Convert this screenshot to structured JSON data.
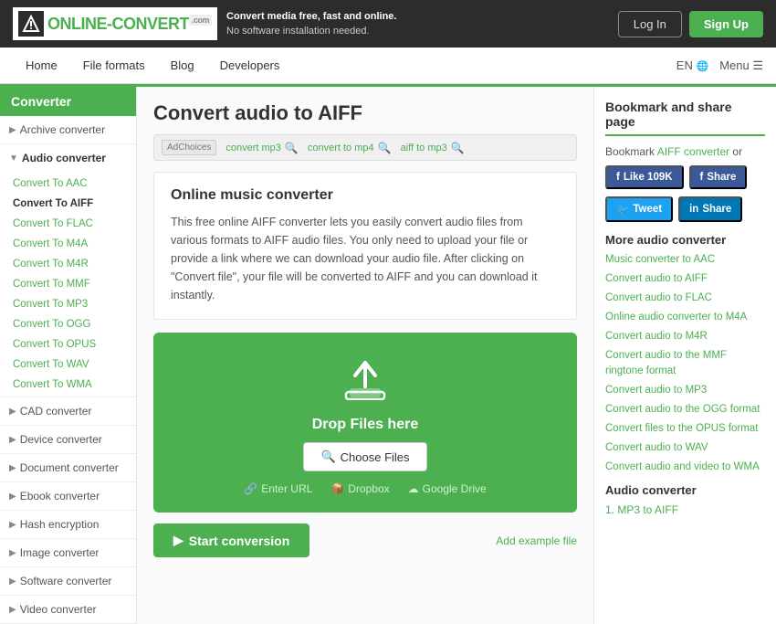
{
  "header": {
    "logo_text": "ONLINE",
    "logo_dash": "-",
    "logo_convert": "CONVERT",
    "logo_com": ".com",
    "tagline_main": "Convert media free, fast and online.",
    "tagline_sub": "No software installation needed.",
    "login_label": "Log In",
    "signup_label": "Sign Up"
  },
  "nav": {
    "items": [
      {
        "label": "Home"
      },
      {
        "label": "File formats"
      },
      {
        "label": "Blog"
      },
      {
        "label": "Developers"
      }
    ],
    "lang": "EN",
    "menu": "Menu"
  },
  "sidebar": {
    "title": "Converter",
    "sections": [
      {
        "label": "Archive converter",
        "open": false
      },
      {
        "label": "Audio converter",
        "open": true,
        "items": [
          "Convert To AAC",
          "Convert To AIFF",
          "Convert To FLAC",
          "Convert To M4A",
          "Convert To M4R",
          "Convert To MMF",
          "Convert To MP3",
          "Convert To OGG",
          "Convert To OPUS",
          "Convert To WAV",
          "Convert To WMA"
        ]
      },
      {
        "label": "CAD converter",
        "open": false
      },
      {
        "label": "Device converter",
        "open": false
      },
      {
        "label": "Document converter",
        "open": false
      },
      {
        "label": "Ebook converter",
        "open": false
      },
      {
        "label": "Hash encryption",
        "open": false
      },
      {
        "label": "Image converter",
        "open": false
      },
      {
        "label": "Software converter",
        "open": false
      },
      {
        "label": "Video converter",
        "open": false
      }
    ]
  },
  "main": {
    "page_title": "Convert audio to AIFF",
    "ad_label": "AdChoices",
    "ad_items": [
      {
        "text": "convert mp3"
      },
      {
        "text": "convert to mp4"
      },
      {
        "text": "aiff to mp3"
      }
    ],
    "converter_subtitle": "Online music converter",
    "converter_desc": "This free online AIFF converter lets you easily convert audio files from various formats to AIFF audio files. You only need to upload your file or provide a link where we can download your audio file. After clicking on \"Convert file\", your file will be converted to AIFF and you can download it instantly.",
    "drop_zone": {
      "drop_text": "Drop Files here",
      "choose_label": "Choose Files",
      "url_label": "Enter URL",
      "dropbox_label": "Dropbox",
      "gdrive_label": "Google Drive"
    },
    "start_label": "Start conversion",
    "add_example": "Add example file"
  },
  "right_sidebar": {
    "title": "Bookmark and share page",
    "bookmark_text": "Bookmark AIFF converter or",
    "bookmark_link": "AIFF converter",
    "social": {
      "like_label": "Like 109K",
      "share_fb_label": "Share",
      "tweet_label": "Tweet",
      "share_li_label": "Share"
    },
    "more_title": "More audio converter",
    "more_links": [
      "Music converter to AAC",
      "Convert audio to AIFF",
      "Convert audio to FLAC",
      "Online audio converter to M4A",
      "Convert audio to M4R",
      "Convert audio to the MMF ringtone format",
      "Convert audio to MP3",
      "Convert audio to the OGG format",
      "Convert files to the OPUS format",
      "Convert audio to WAV",
      "Convert audio and video to WMA"
    ],
    "audio_title": "Audio converter",
    "audio_items": [
      "1. MP3 to AIFF"
    ]
  }
}
